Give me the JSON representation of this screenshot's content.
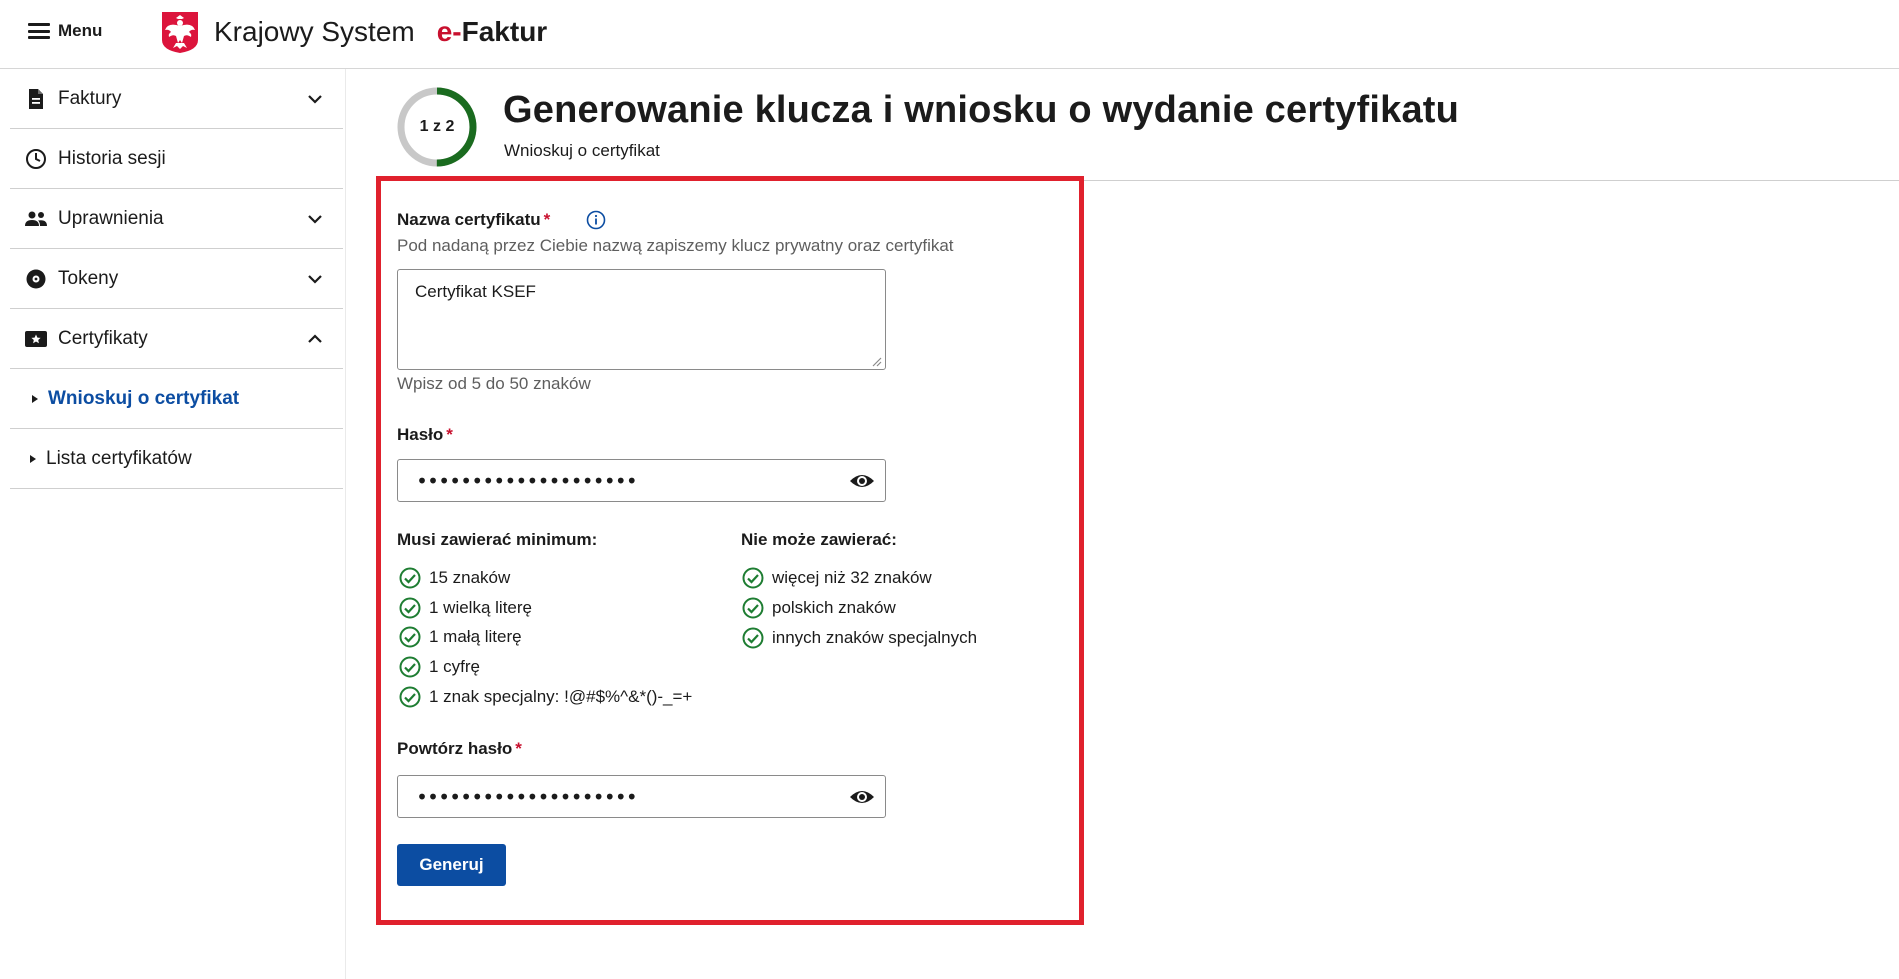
{
  "header": {
    "menu_label": "Menu",
    "brand_part1": "Krajowy System",
    "brand_part2": "e-",
    "brand_part3": "Faktur"
  },
  "sidebar": {
    "items": [
      {
        "label": "Faktury",
        "icon": "document-icon",
        "chevron": "down"
      },
      {
        "label": "Historia sesji",
        "icon": "clock-icon"
      },
      {
        "label": "Uprawnienia",
        "icon": "people-icon",
        "chevron": "down"
      },
      {
        "label": "Tokeny",
        "icon": "token-icon",
        "chevron": "down"
      },
      {
        "label": "Certyfikaty",
        "icon": "certificate-icon",
        "chevron": "up"
      }
    ],
    "sub_items": [
      {
        "label": "Wnioskuj o certyfikat",
        "active": true
      },
      {
        "label": "Lista certyfikatów",
        "active": false
      }
    ]
  },
  "page": {
    "step": "1 z 2",
    "step_progress": 0.5,
    "title": "Generowanie klucza i wniosku o wydanie certyfikatu",
    "subtitle": "Wnioskuj o certyfikat"
  },
  "form": {
    "name_label": "Nazwa certyfikatu",
    "name_hint": "Pod nadaną przez Ciebie nazwą zapiszemy klucz prywatny oraz certyfikat",
    "name_value": "Certyfikat KSEF",
    "name_length_hint": "Wpisz od 5 do 50 znaków",
    "password_label": "Hasło",
    "password_dots": "••••••••••••••••••••",
    "must_contain_title": "Musi zawierać minimum:",
    "must_contain": [
      "15 znaków",
      "1 wielką literę",
      "1 małą literę",
      "1 cyfrę",
      "1 znak specjalny: !@#$%^&*()-_=+"
    ],
    "cannot_contain_title": "Nie może zawierać:",
    "cannot_contain": [
      "więcej niż 32 znaków",
      "polskich znaków",
      "innych znaków specjalnych"
    ],
    "repeat_label": "Powtórz hasło",
    "repeat_dots": "••••••••••••••••••••",
    "required_mark": "*",
    "submit_label": "Generuj"
  },
  "colors": {
    "accent": "#0c4da2",
    "required": "#c8102e",
    "success": "#1e7d32",
    "highlight_border": "#e0212d",
    "progress_track": "#c8c8c8",
    "progress_fill": "#1a6b1f"
  }
}
